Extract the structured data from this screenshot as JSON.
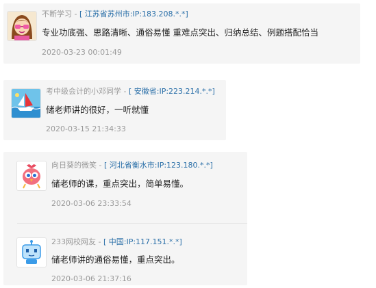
{
  "comments": [
    {
      "name": "不断学习",
      "separator": " - ",
      "location": "[ 江苏省苏州市:IP:183.208.*.*]",
      "content": "专业功底强、思路清晰、通俗易懂 重难点突出、归纳总结、例题搭配恰当",
      "time": "2020-03-23 00:01:49",
      "avatar_icon": "cartoon-girl-avatar-icon"
    },
    {
      "name": "考中级会计的小邓同学",
      "separator": " - ",
      "location": "[ 安徽省:IP:223.214.*.*]",
      "content": "储老师讲的很好，一听就懂",
      "time": "2020-03-15 21:34:33",
      "avatar_icon": "sailboat-avatar-icon"
    },
    {
      "name": "向日葵的微笑",
      "separator": " - ",
      "location": "[ 河北省衡水市:IP:123.180.*.*]",
      "content": "储老师的课，重点突出，简单易懂。",
      "time": "2020-03-06 23:33:54",
      "avatar_icon": "cartoon-bird-avatar-icon"
    },
    {
      "name": "233网校网友",
      "separator": " - ",
      "location": "[ 中国:IP:117.151.*.*]",
      "content": "储老师讲的通俗易懂，重点突出。",
      "time": "2020-03-06 21:37:16",
      "avatar_icon": "robot-avatar-icon"
    }
  ],
  "colors": {
    "card_background": "#f5f5f5",
    "name_text": "#999999",
    "location_link": "#2a6fa8",
    "content_text": "#222222",
    "timestamp_text": "#999999"
  }
}
